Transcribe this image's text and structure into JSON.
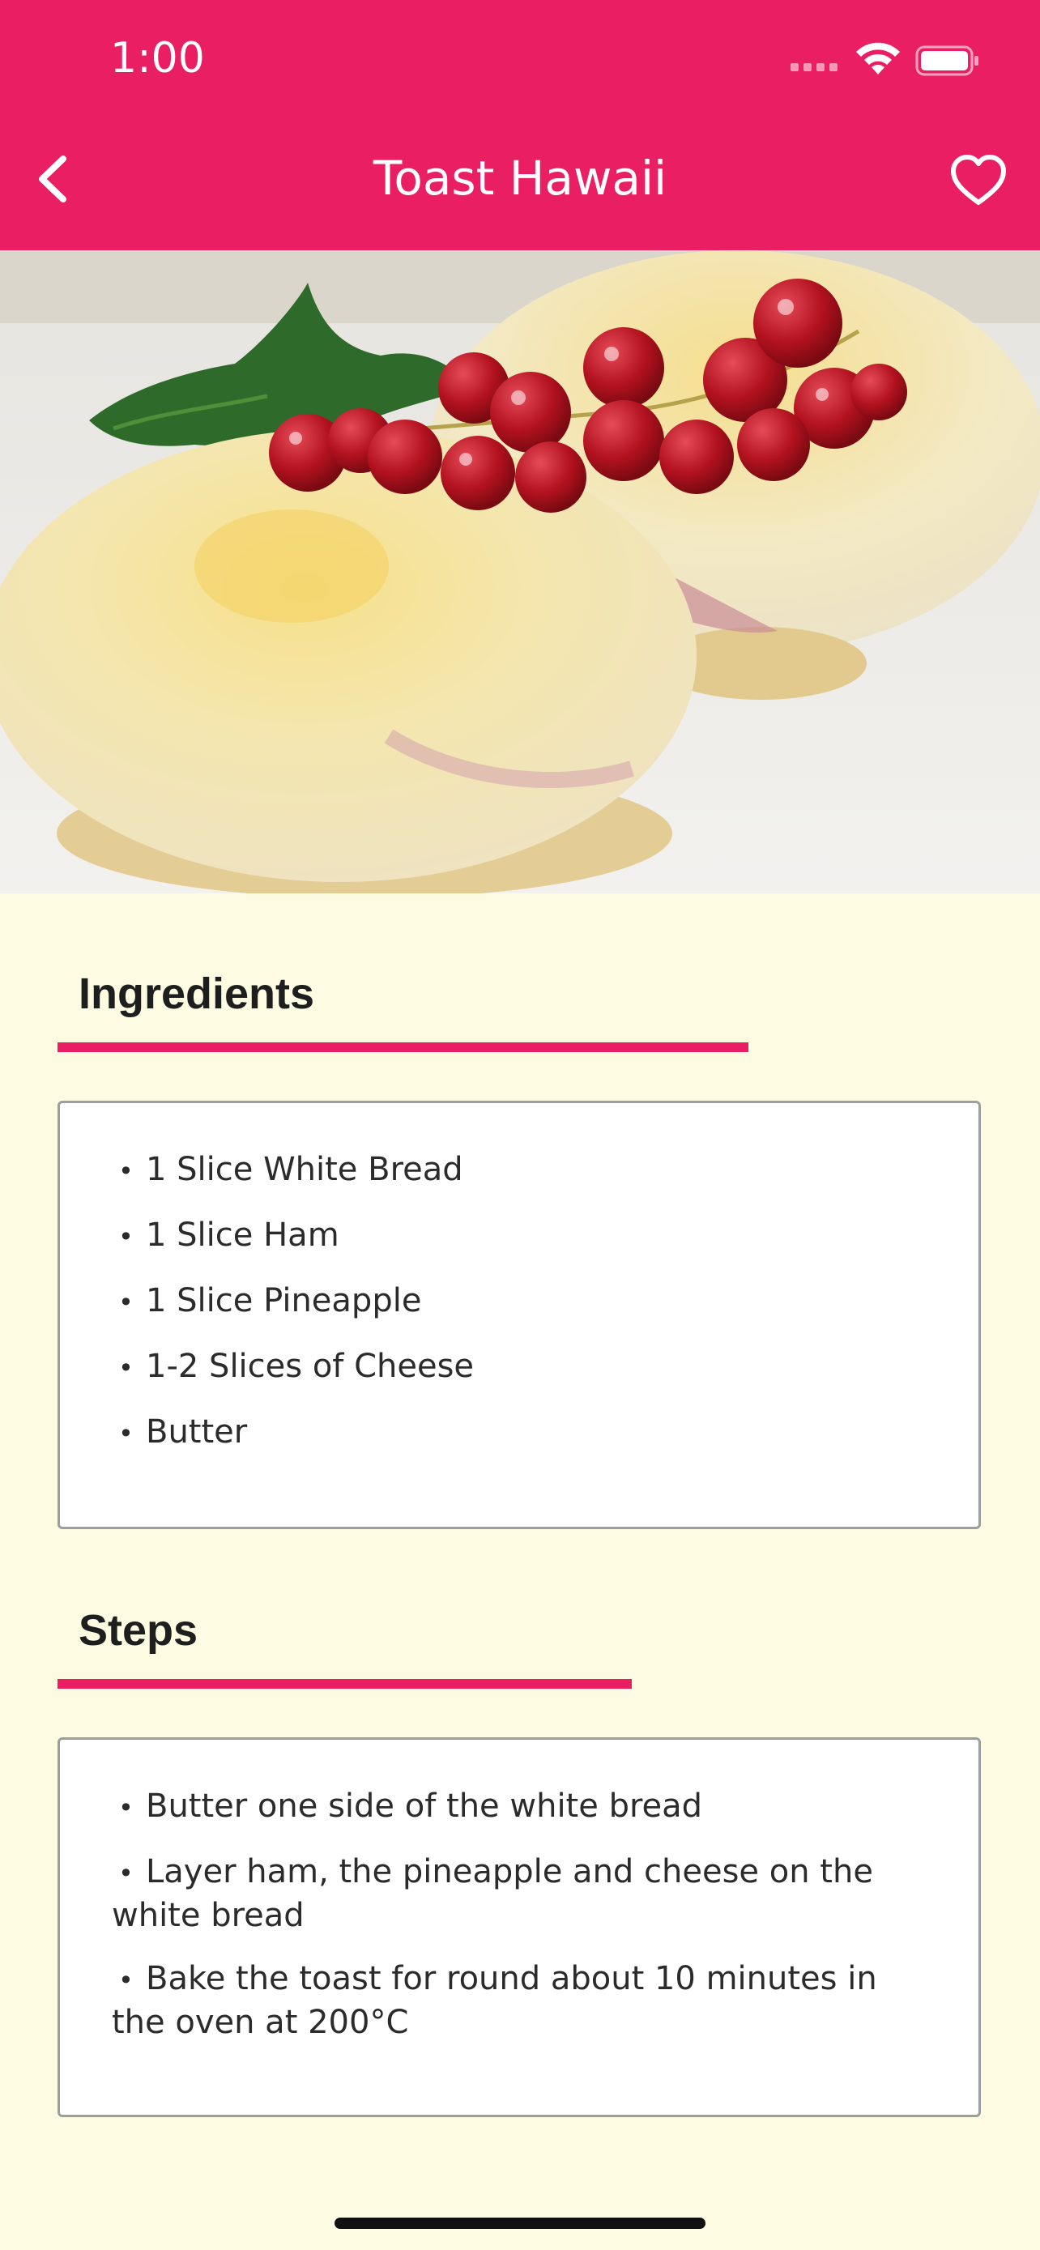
{
  "status_bar": {
    "time": "1:00"
  },
  "nav": {
    "title": "Toast Hawaii"
  },
  "colors": {
    "accent": "#E91E63",
    "background": "#FEFBE3",
    "card": "#FFFFFF"
  },
  "icons": {
    "back": "chevron-left-icon",
    "favorite": "heart-outline-icon",
    "wifi": "wifi-icon",
    "battery": "battery-icon",
    "cellular": "cellular-signal-icon"
  },
  "ingredients": {
    "title": "Ingredients",
    "items": [
      "1 Slice White Bread",
      "1 Slice Ham",
      "1 Slice Pineapple",
      "1-2 Slices of Cheese",
      "Butter"
    ]
  },
  "steps": {
    "title": "Steps",
    "items": [
      "Butter one side of the white bread",
      "Layer ham, the pineapple and cheese on the white bread",
      "Bake the toast for round about 10 minutes in the oven at 200°C"
    ]
  }
}
